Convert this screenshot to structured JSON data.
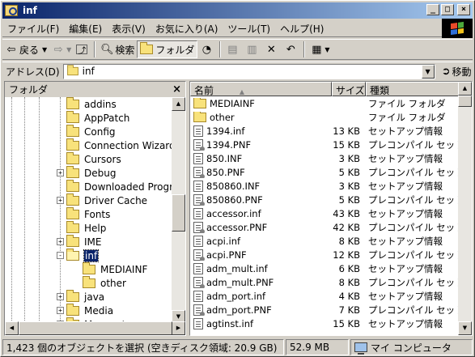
{
  "window": {
    "title": "inf"
  },
  "menu": [
    "ファイル(F)",
    "編集(E)",
    "表示(V)",
    "お気に入り(A)",
    "ツール(T)",
    "ヘルプ(H)"
  ],
  "toolbar": {
    "back": "戻る",
    "search": "検索",
    "folders": "フォルダ"
  },
  "address": {
    "label": "アドレス(D)",
    "value": "inf",
    "go": "移動"
  },
  "folders_pane": {
    "title": "フォルダ",
    "close": "×",
    "items": [
      {
        "label": "addins",
        "level": 0,
        "expander": ""
      },
      {
        "label": "AppPatch",
        "level": 0,
        "expander": ""
      },
      {
        "label": "Config",
        "level": 0,
        "expander": ""
      },
      {
        "label": "Connection Wizard",
        "level": 0,
        "expander": ""
      },
      {
        "label": "Cursors",
        "level": 0,
        "expander": ""
      },
      {
        "label": "Debug",
        "level": 0,
        "expander": "+"
      },
      {
        "label": "Downloaded Program Files",
        "level": 0,
        "expander": ""
      },
      {
        "label": "Driver Cache",
        "level": 0,
        "expander": "+"
      },
      {
        "label": "Fonts",
        "level": 0,
        "expander": ""
      },
      {
        "label": "Help",
        "level": 0,
        "expander": ""
      },
      {
        "label": "IME",
        "level": 0,
        "expander": "+"
      },
      {
        "label": "inf",
        "level": 0,
        "expander": "-",
        "selected": true
      },
      {
        "label": "MEDIAINF",
        "level": 1,
        "expander": ""
      },
      {
        "label": "other",
        "level": 1,
        "expander": ""
      },
      {
        "label": "java",
        "level": 0,
        "expander": "+"
      },
      {
        "label": "Media",
        "level": 0,
        "expander": "+"
      },
      {
        "label": "Msagent",
        "level": 0,
        "expander": "+"
      }
    ]
  },
  "list": {
    "columns": {
      "name": "名前",
      "sort": "▲",
      "size": "サイズ",
      "type": "種類"
    },
    "rows": [
      {
        "name": "MEDIAINF",
        "size": "",
        "type": "ファイル フォルダ",
        "icon": "folder"
      },
      {
        "name": "other",
        "size": "",
        "type": "ファイル フォルダ",
        "icon": "folder"
      },
      {
        "name": "1394.inf",
        "size": "13 KB",
        "type": "セットアップ情報",
        "icon": "inf"
      },
      {
        "name": "1394.PNF",
        "size": "15 KB",
        "type": "プレコンパイル セットアップ",
        "icon": "pnf"
      },
      {
        "name": "850.INF",
        "size": "3 KB",
        "type": "セットアップ情報",
        "icon": "inf"
      },
      {
        "name": "850.PNF",
        "size": "5 KB",
        "type": "プレコンパイル セットアップ",
        "icon": "pnf"
      },
      {
        "name": "850860.INF",
        "size": "3 KB",
        "type": "セットアップ情報",
        "icon": "inf"
      },
      {
        "name": "850860.PNF",
        "size": "5 KB",
        "type": "プレコンパイル セットアップ",
        "icon": "pnf"
      },
      {
        "name": "accessor.inf",
        "size": "43 KB",
        "type": "セットアップ情報",
        "icon": "inf"
      },
      {
        "name": "accessor.PNF",
        "size": "42 KB",
        "type": "プレコンパイル セットアップ",
        "icon": "pnf"
      },
      {
        "name": "acpi.inf",
        "size": "8 KB",
        "type": "セットアップ情報",
        "icon": "inf"
      },
      {
        "name": "acpi.PNF",
        "size": "12 KB",
        "type": "プレコンパイル セットアップ",
        "icon": "pnf"
      },
      {
        "name": "adm_mult.inf",
        "size": "6 KB",
        "type": "セットアップ情報",
        "icon": "inf"
      },
      {
        "name": "adm_mult.PNF",
        "size": "8 KB",
        "type": "プレコンパイル セットアップ",
        "icon": "pnf"
      },
      {
        "name": "adm_port.inf",
        "size": "4 KB",
        "type": "セットアップ情報",
        "icon": "inf"
      },
      {
        "name": "adm_port.PNF",
        "size": "7 KB",
        "type": "プレコンパイル セットアップ",
        "icon": "pnf"
      },
      {
        "name": "agtinst.inf",
        "size": "15 KB",
        "type": "セットアップ情報",
        "icon": "inf"
      }
    ]
  },
  "status": {
    "selection": "1,423 個のオブジェクトを選択 (空きディスク領域: 20.9 GB)",
    "size": "52.9 MB",
    "location": "マイ コンピュータ"
  },
  "colors": {
    "titlebar_start": "#0a246a",
    "titlebar_end": "#a6caf0",
    "selection": "#0a246a",
    "face": "#d4d0c8"
  }
}
